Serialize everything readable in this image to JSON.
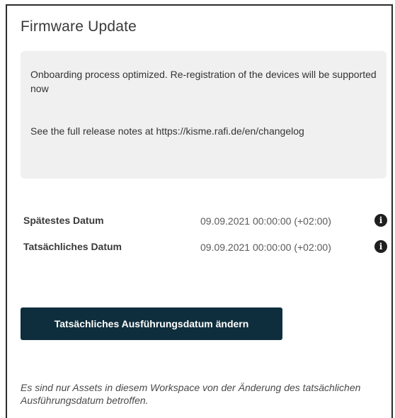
{
  "panel": {
    "title": "Firmware Update"
  },
  "release_notes": {
    "line1": "Onboarding process optimized. Re-registration of the devices will be supported now",
    "line2": "See the full release notes at https://kisme.rafi.de/en/changelog"
  },
  "dates": [
    {
      "label": "Spätestes Datum",
      "value": "09.09.2021 00:00:00 (+02:00)",
      "icon": "info-icon"
    },
    {
      "label": "Tatsächliches Datum",
      "value": "09.09.2021 00:00:00 (+02:00)",
      "icon": "info-icon"
    }
  ],
  "actions": {
    "change_date_label": "Tatsächliches Ausführungsdatum ändern"
  },
  "footer_note": "Es sind nur Assets in diesem Workspace von der Änderung des tatsächlichen Ausführungsdatum betroffen.",
  "colors": {
    "button_bg": "#0f2e3d",
    "notes_bg": "#f0f0f0"
  }
}
